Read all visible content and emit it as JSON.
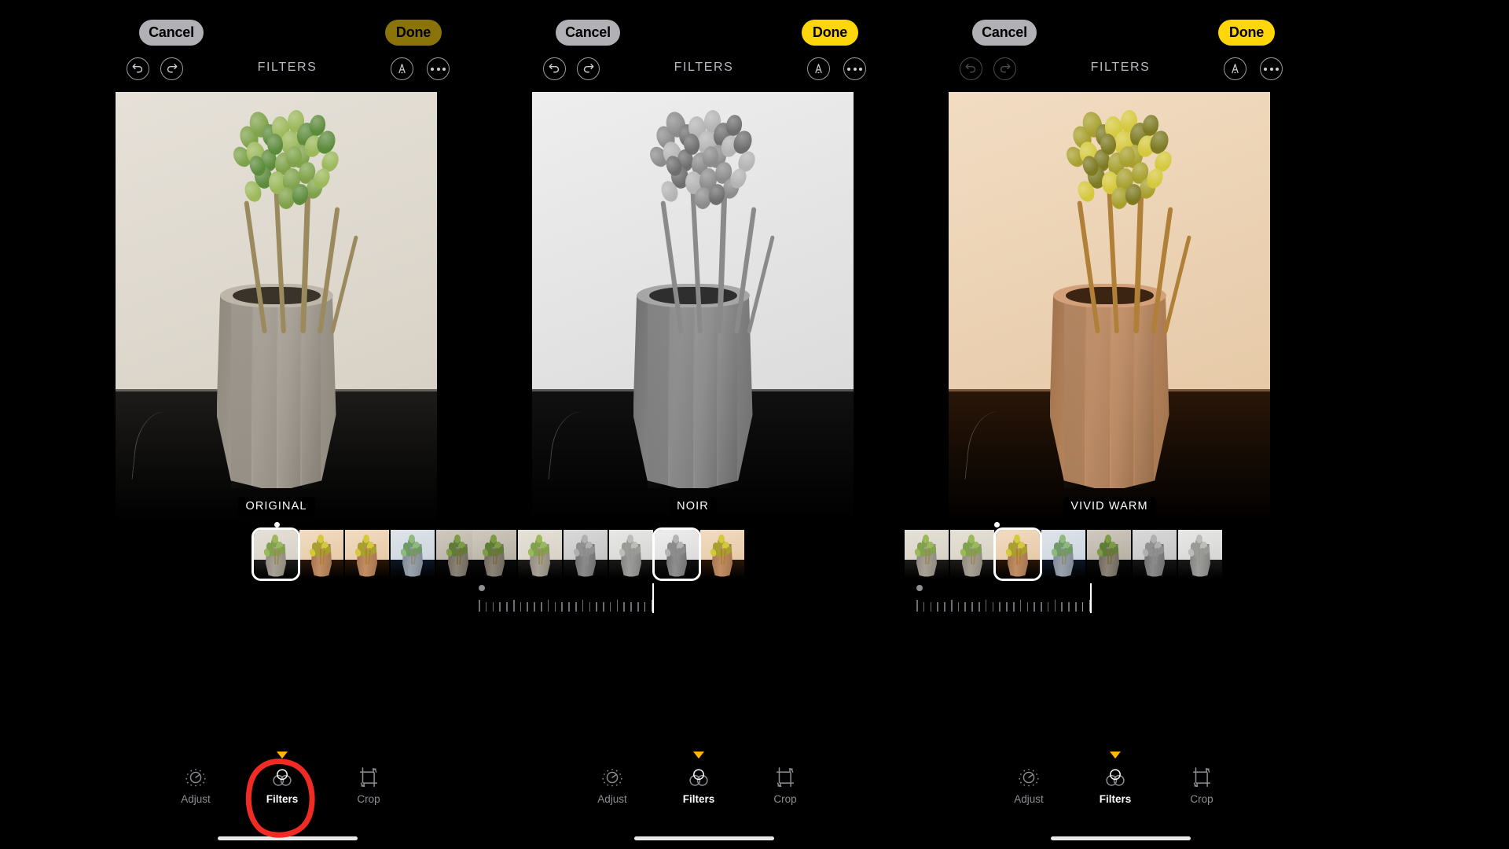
{
  "app": {
    "screen_title": "FILTERS"
  },
  "panels": [
    {
      "id": "panel-original",
      "cancel_label": "Cancel",
      "done_label": "Done",
      "done_state": "dimmed",
      "title": "FILTERS",
      "undo_icon": "undo-icon",
      "redo_icon": "redo-icon",
      "auto_icon": "auto-enhance-icon",
      "more_icon": "more-options-icon",
      "filter_badge": "ORIGINAL",
      "selected_filter_index": 0,
      "page_dot_visible": true,
      "slider_visible": false,
      "slider_value": null,
      "tabs": [
        {
          "label": "Adjust",
          "icon": "adjust-dial-icon",
          "active": false
        },
        {
          "label": "Filters",
          "icon": "filters-circles-icon",
          "active": true
        },
        {
          "label": "Crop",
          "icon": "crop-rotate-icon",
          "active": false
        }
      ],
      "annotation": {
        "type": "red-circle",
        "target": "Filters"
      }
    },
    {
      "id": "panel-noir",
      "cancel_label": "Cancel",
      "done_label": "Done",
      "done_state": "active",
      "title": "FILTERS",
      "undo_icon": "undo-icon",
      "redo_icon": "redo-icon",
      "auto_icon": "auto-enhance-icon",
      "more_icon": "more-options-icon",
      "filter_badge": "NOIR",
      "selected_filter_index": 4,
      "page_dot_visible": false,
      "slider_visible": true,
      "slider_value": 100,
      "tabs": [
        {
          "label": "Adjust",
          "icon": "adjust-dial-icon",
          "active": false
        },
        {
          "label": "Filters",
          "icon": "filters-circles-icon",
          "active": true
        },
        {
          "label": "Crop",
          "icon": "crop-rotate-icon",
          "active": false
        }
      ],
      "annotation": null
    },
    {
      "id": "panel-vivid-warm",
      "cancel_label": "Cancel",
      "done_label": "Done",
      "done_state": "active",
      "title": "FILTERS",
      "undo_icon": "undo-icon",
      "redo_icon": "redo-icon",
      "auto_icon": "auto-enhance-icon",
      "more_icon": "more-options-icon",
      "filter_badge": "VIVID WARM",
      "selected_filter_index": 2,
      "page_dot_visible": true,
      "slider_visible": true,
      "slider_value": 100,
      "tabs": [
        {
          "label": "Adjust",
          "icon": "adjust-dial-icon",
          "active": false
        },
        {
          "label": "Filters",
          "icon": "filters-circles-icon",
          "active": true
        },
        {
          "label": "Crop",
          "icon": "crop-rotate-icon",
          "active": false
        }
      ],
      "annotation": null
    }
  ],
  "colors": {
    "background": "#000000",
    "done_active": "#ffd60a",
    "done_dimmed": "#8a7308",
    "cancel_pill": "#b0b0b5",
    "tab_active_text": "#ffffff",
    "tab_inactive_text": "#8e8e93",
    "tab_indicator": "#ffb800",
    "annotation_red": "#ef2b24",
    "badge_background": "#000000",
    "badge_text": "#ffffff",
    "home_bar": "#e8e8e8"
  }
}
